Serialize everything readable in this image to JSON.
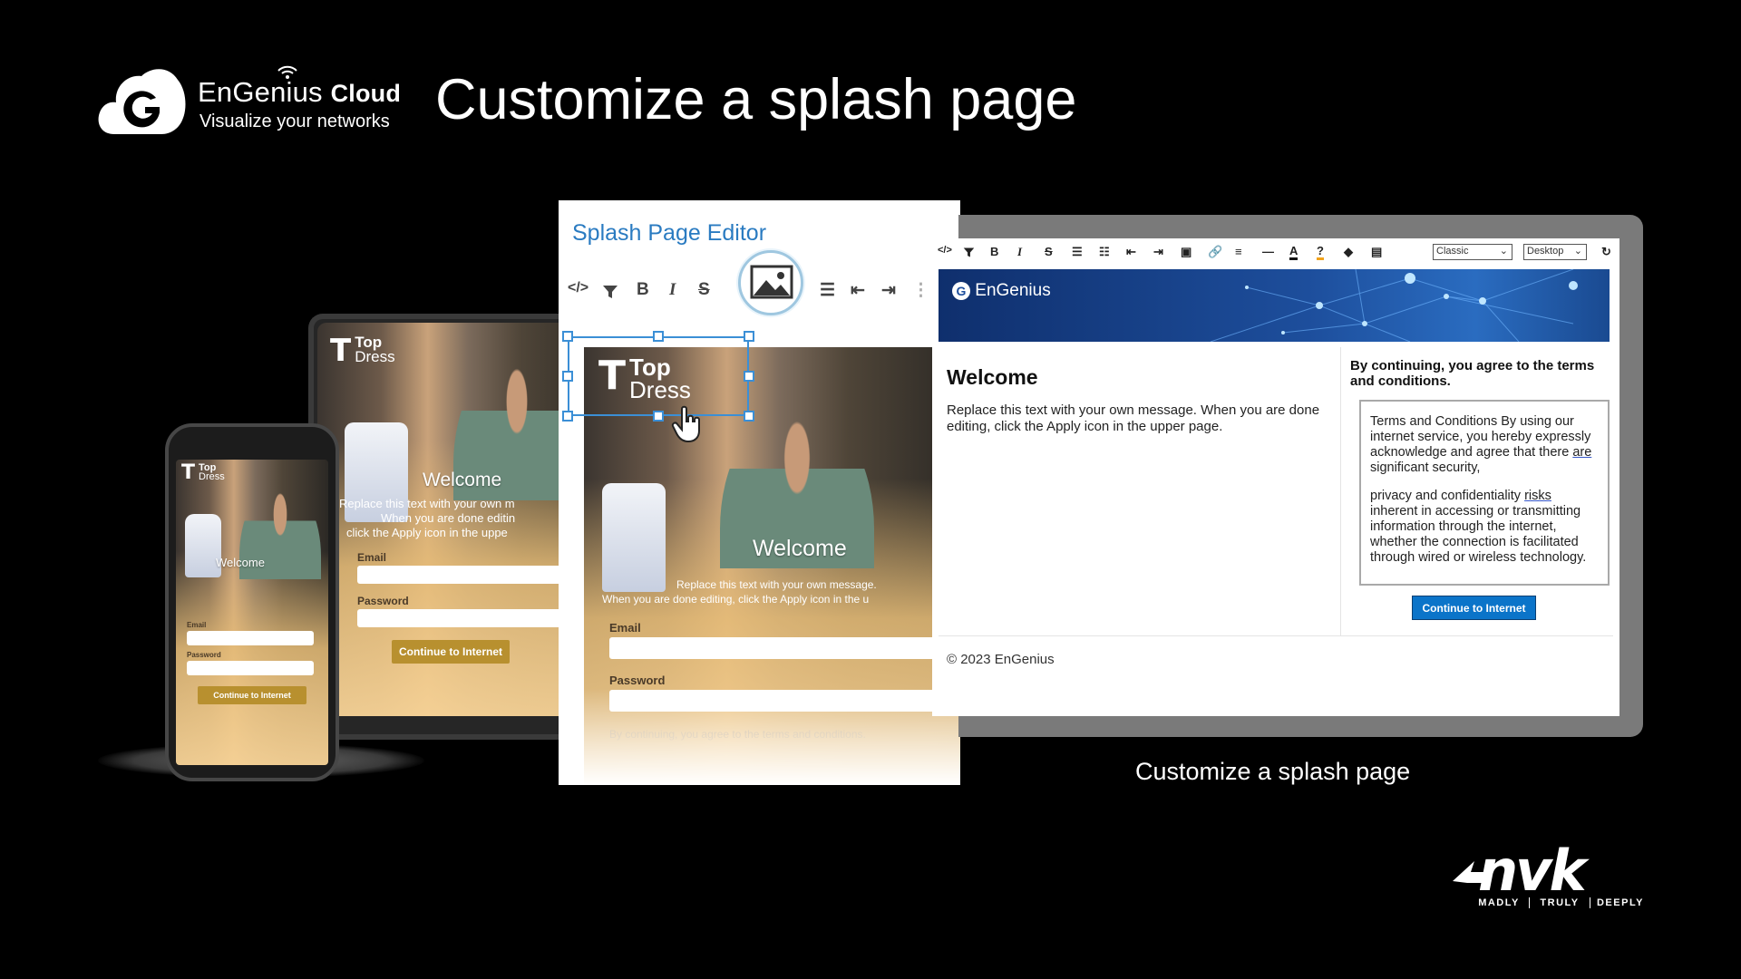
{
  "header": {
    "brand_name": "EnGenius",
    "brand_cloud_word": "Cloud",
    "brand_tagline": "Visualize your networks",
    "title": "Customize a splash page"
  },
  "mockup": {
    "logo_top": "Top",
    "logo_dress": "Dress",
    "welcome": "Welcome",
    "laptop_text_line1": "Replace this text with your own m",
    "laptop_text_line2": "When you are done editin",
    "laptop_text_line3": "click the Apply icon in the uppe",
    "email_label": "Email",
    "password_label": "Password",
    "continue_button": "Continue to Internet"
  },
  "editor": {
    "title": "Splash Page Editor",
    "logo_top": "Top",
    "logo_dress": "Dress",
    "welcome": "Welcome",
    "text_line1": "Replace this text with your own message.",
    "text_line2": "When you are done editing, click the Apply icon in the u",
    "email_label": "Email",
    "password_label": "Password",
    "agree_text": "By continuing, you agree to the terms and conditions."
  },
  "preview": {
    "toolbar_select_style": "Classic",
    "toolbar_select_device": "Desktop",
    "banner_logo": "EnGenius",
    "welcome_heading": "Welcome",
    "welcome_body": "Replace this text with your own message. When you are done editing, click the Apply icon in the upper page.",
    "agree_heading": "By continuing, you agree to the terms and conditions.",
    "terms_p1": "Terms and Conditions By using our internet service, you hereby expressly acknowledge and agree that there ",
    "terms_p1_ul": "are",
    "terms_p1_end": " significant security,",
    "terms_p2_start": "privacy and confidentiality ",
    "terms_p2_ul": "risks",
    "terms_p2_end": " inherent in accessing or transmitting information through the internet, whether the connection is facilitated through wired or wireless technology.",
    "continue_button": "Continue to Internet",
    "footer": "© 2023 EnGenius"
  },
  "caption": "Customize a splash page",
  "nvk": {
    "word1": "MADLY",
    "word2": "TRULY",
    "word3": "DEEPLY"
  },
  "colors": {
    "editor_title": "#2a7bc1",
    "button_blue": "#0b74c9",
    "mock_button_gold": "#b8902f",
    "banner_blue": "#1d4e9c"
  }
}
